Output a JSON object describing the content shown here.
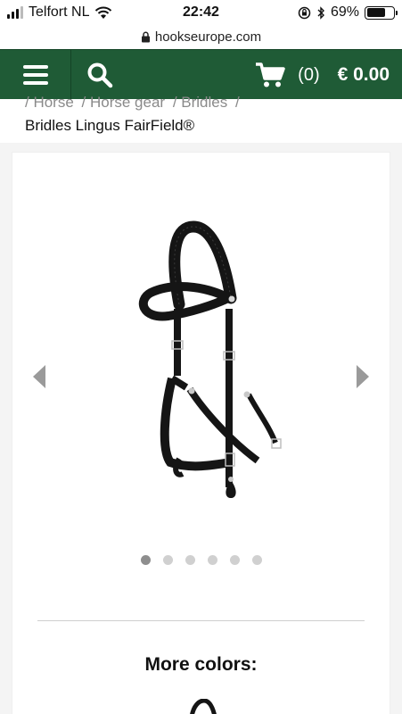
{
  "status_bar": {
    "carrier": "Telfort NL",
    "time": "22:42",
    "battery": "69%",
    "battery_level": 0.69,
    "icons": [
      "signal-icon",
      "wifi-icon",
      "rotation-lock-icon",
      "bluetooth-icon",
      "battery-icon"
    ]
  },
  "browser": {
    "url": "hookseurope.com",
    "lock_icon": "lock-icon"
  },
  "header": {
    "menu_icon": "hamburger-menu-icon",
    "search_icon": "search-icon",
    "cart_icon": "shopping-cart-icon",
    "cart_count": "(0)",
    "cart_total": "€ 0.00",
    "brand_color": "#1f5b36"
  },
  "breadcrumb": {
    "items": [
      "/ Horse",
      "/ Horse gear",
      "/ Bridles",
      "/"
    ]
  },
  "product": {
    "title": "Bridles Lingus FairField®",
    "gallery": {
      "prev_icon": "chevron-left-icon",
      "next_icon": "chevron-right-icon",
      "slide_count": 6,
      "active_slide": 1
    },
    "more_colors_label": "More colors:"
  }
}
